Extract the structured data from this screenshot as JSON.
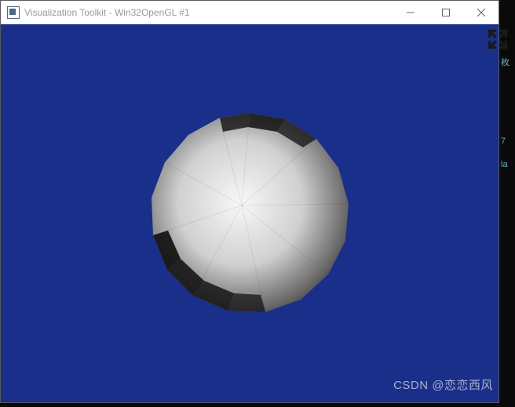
{
  "window": {
    "title": "Visualization Toolkit - Win32OpenGL #1"
  },
  "viewport": {
    "background_color": "#1a2f8a",
    "object": "low-poly-sphere",
    "object_color_light": "#f5f5f5",
    "object_color_dark": "#1e1e1e"
  },
  "watermark": {
    "text": "CSDN @恋恋西风"
  },
  "side": {
    "frag1": "枚",
    "frag2": "7",
    "frag3": "la"
  }
}
